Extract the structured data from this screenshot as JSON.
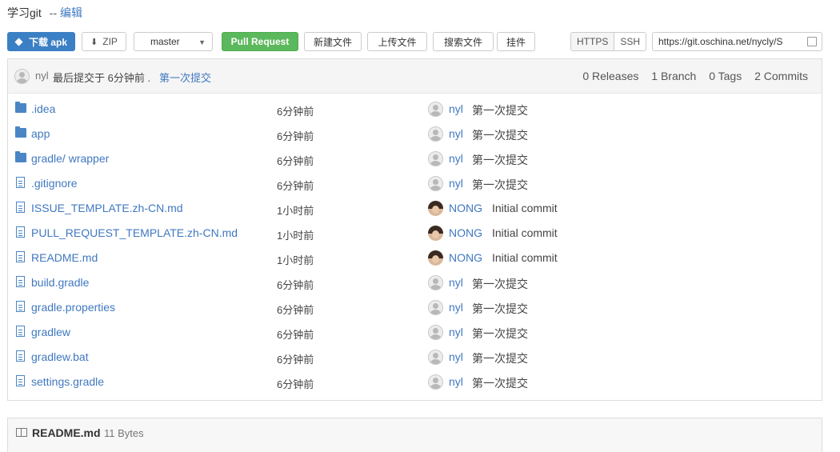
{
  "header": {
    "title": "学习git",
    "separator": "--",
    "edit_label": "编辑"
  },
  "toolbar": {
    "download_apk": "下载 apk",
    "zip": "ZIP",
    "branch": "master",
    "pull_request": "Pull Request",
    "new_file": "新建文件",
    "upload_file": "上传文件",
    "search_file": "搜索文件",
    "plugin": "挂件",
    "https": "HTTPS",
    "ssh": "SSH",
    "clone_url": "https://git.oschina.net/nycly/S"
  },
  "commit": {
    "author": "nyl",
    "text": "最后提交于 6分钟前 .",
    "message": "第一次提交"
  },
  "stats": {
    "releases": "0 Releases",
    "branch": "1 Branch",
    "tags": "0 Tags",
    "commits": "2 Commits"
  },
  "files": [
    {
      "type": "folder",
      "name": ".idea",
      "time": "6分钟前",
      "author": "nyl",
      "avatar": "default",
      "message": "第一次提交"
    },
    {
      "type": "folder",
      "name": "app",
      "time": "6分钟前",
      "author": "nyl",
      "avatar": "default",
      "message": "第一次提交"
    },
    {
      "type": "folder",
      "name": "gradle/",
      "name_sub": "wrapper",
      "time": "6分钟前",
      "author": "nyl",
      "avatar": "default",
      "message": "第一次提交"
    },
    {
      "type": "file",
      "name": ".gitignore",
      "time": "6分钟前",
      "author": "nyl",
      "avatar": "default",
      "message": "第一次提交"
    },
    {
      "type": "file",
      "name": "ISSUE_TEMPLATE.zh-CN.md",
      "time": "1小时前",
      "author": "NONG",
      "avatar": "photo",
      "message": "Initial commit"
    },
    {
      "type": "file",
      "name": "PULL_REQUEST_TEMPLATE.zh-CN.md",
      "time": "1小时前",
      "author": "NONG",
      "avatar": "photo",
      "message": "Initial commit"
    },
    {
      "type": "file",
      "name": "README.md",
      "time": "1小时前",
      "author": "NONG",
      "avatar": "photo",
      "message": "Initial commit"
    },
    {
      "type": "file",
      "name": "build.gradle",
      "time": "6分钟前",
      "author": "nyl",
      "avatar": "default",
      "message": "第一次提交"
    },
    {
      "type": "file",
      "name": "gradle.properties",
      "time": "6分钟前",
      "author": "nyl",
      "avatar": "default",
      "message": "第一次提交"
    },
    {
      "type": "file",
      "name": "gradlew",
      "time": "6分钟前",
      "author": "nyl",
      "avatar": "default",
      "message": "第一次提交"
    },
    {
      "type": "file",
      "name": "gradlew.bat",
      "time": "6分钟前",
      "author": "nyl",
      "avatar": "default",
      "message": "第一次提交"
    },
    {
      "type": "file",
      "name": "settings.gradle",
      "time": "6分钟前",
      "author": "nyl",
      "avatar": "default",
      "message": "第一次提交"
    }
  ],
  "readme": {
    "name": "README.md",
    "size": "11 Bytes"
  }
}
